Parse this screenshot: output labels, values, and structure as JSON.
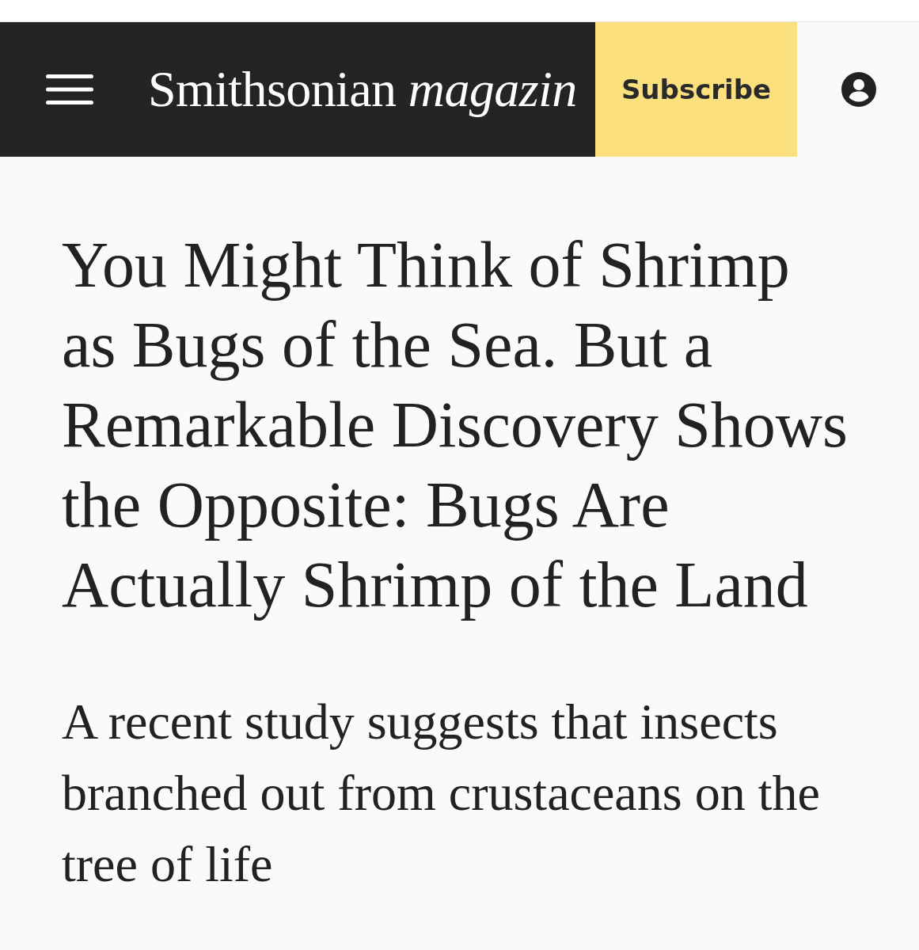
{
  "header": {
    "logo": "Smithsonian *magazin*",
    "subscribe_button": "Subscribe"
  },
  "article": {
    "headline": "You Might Think of Shrimp as Bugs of the Sea. But a Remarkable Discovery Shows the Opposite: Bugs Are Actually Shrimp of the Land",
    "dek": "A recent study suggests that insects branched out from crustaceans on the tree of life"
  }
}
